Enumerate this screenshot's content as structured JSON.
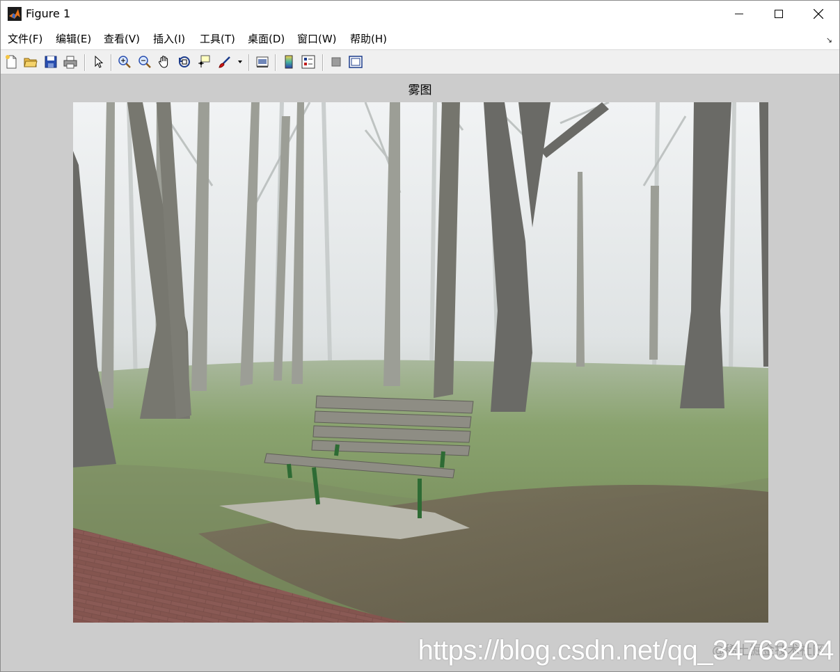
{
  "window": {
    "title": "Figure 1"
  },
  "menu": {
    "items": [
      {
        "label": "文件(F)"
      },
      {
        "label": "编辑(E)"
      },
      {
        "label": "查看(V)"
      },
      {
        "label": "插入(I)"
      },
      {
        "label": "工具(T)"
      },
      {
        "label": "桌面(D)"
      },
      {
        "label": "窗口(W)"
      },
      {
        "label": "帮助(H)"
      }
    ],
    "dock_arrow": "↘"
  },
  "toolbar": {
    "icons": [
      "new-figure-icon",
      "open-file-icon",
      "save-icon",
      "print-icon",
      "pointer-icon",
      "zoom-in-icon",
      "zoom-out-icon",
      "pan-hand-icon",
      "rotate-3d-icon",
      "data-cursor-icon",
      "brush-icon",
      "dropdown-arrow-icon",
      "link-plot-icon",
      "colorbar-icon",
      "legend-icon",
      "hide-plot-tools-icon",
      "show-plot-tools-icon"
    ]
  },
  "figure": {
    "title": "雾图"
  },
  "watermark": {
    "url": "https://blog.csdn.net/qq_34763204",
    "sub": "@稀土掘金技术社区"
  }
}
